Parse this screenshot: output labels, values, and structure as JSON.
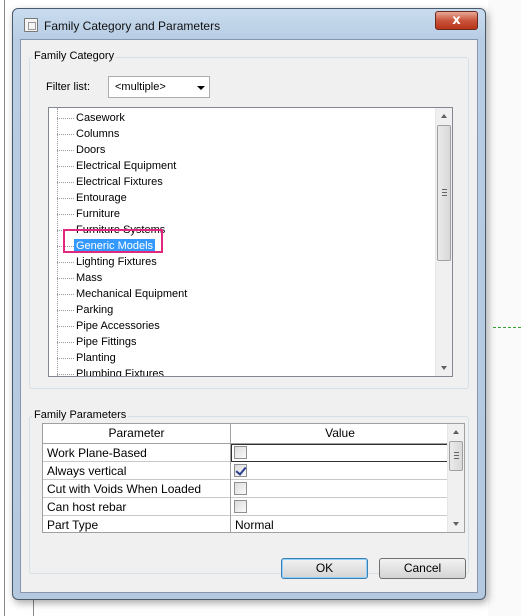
{
  "window": {
    "title": "Family Category and Parameters",
    "close_glyph": "x"
  },
  "family_category": {
    "group_label": "Family Category",
    "filter_label": "Filter list:",
    "filter_value": "<multiple>",
    "items": [
      "Casework",
      "Columns",
      "Doors",
      "Electrical Equipment",
      "Electrical Fixtures",
      "Entourage",
      "Furniture",
      "Furniture Systems",
      "Generic Models",
      "Lighting Fixtures",
      "Mass",
      "Mechanical Equipment",
      "Parking",
      "Pipe Accessories",
      "Pipe Fittings",
      "Planting",
      "Plumbing Fixtures"
    ],
    "selected_item": "Generic Models"
  },
  "family_parameters": {
    "group_label": "Family Parameters",
    "columns": [
      "Parameter",
      "Value"
    ],
    "rows": [
      {
        "name": "Work Plane-Based",
        "type": "checkbox",
        "checked": false
      },
      {
        "name": "Always vertical",
        "type": "checkbox",
        "checked": true
      },
      {
        "name": "Cut with Voids When Loaded",
        "type": "checkbox",
        "checked": false
      },
      {
        "name": "Can host rebar",
        "type": "checkbox",
        "checked": false
      },
      {
        "name": "Part Type",
        "type": "text",
        "value": "Normal"
      }
    ]
  },
  "buttons": {
    "ok": "OK",
    "cancel": "Cancel"
  },
  "colors": {
    "selection": "#3399ff",
    "highlight_box": "#e0287e",
    "close_button": "#c9553c"
  }
}
